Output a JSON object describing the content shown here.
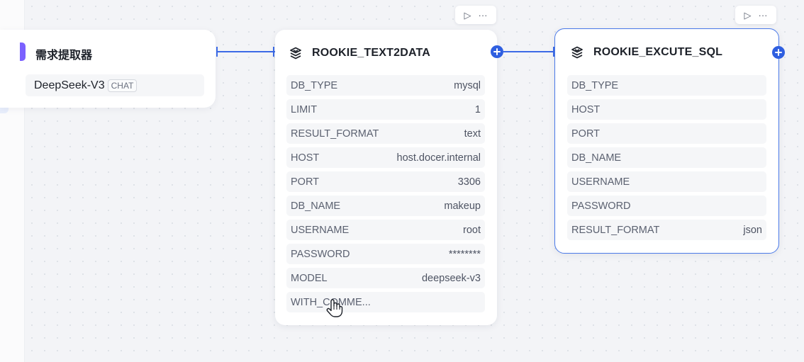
{
  "colors": {
    "accent": "#2f5fe0",
    "edge": "#3c6ae6",
    "selected_border": "#4a79e8",
    "extractor_edge": "#7b61ff"
  },
  "toolbar": {
    "run_icon": "play-icon",
    "more_icon": "more-icon",
    "run_glyph": "▷",
    "more_glyph": "···"
  },
  "extractor_node": {
    "title": "需求提取器",
    "model": "DeepSeek-V3",
    "model_tag": "CHAT"
  },
  "text2data_node": {
    "title": "ROOKIE_TEXT2DATA",
    "params": [
      {
        "name": "DB_TYPE",
        "value": "mysql"
      },
      {
        "name": "LIMIT",
        "value": "1"
      },
      {
        "name": "RESULT_FORMAT",
        "value": "text"
      },
      {
        "name": "HOST",
        "value": "host.docer.internal"
      },
      {
        "name": "PORT",
        "value": "3306"
      },
      {
        "name": "DB_NAME",
        "value": "makeup"
      },
      {
        "name": "USERNAME",
        "value": "root"
      },
      {
        "name": "PASSWORD",
        "value": "********"
      },
      {
        "name": "MODEL",
        "value": "deepseek-v3"
      },
      {
        "name": "WITH_COMME...",
        "value": ""
      }
    ]
  },
  "excute_sql_node": {
    "title": "ROOKIE_EXCUTE_SQL",
    "params": [
      {
        "name": "DB_TYPE",
        "value": ""
      },
      {
        "name": "HOST",
        "value": ""
      },
      {
        "name": "PORT",
        "value": ""
      },
      {
        "name": "DB_NAME",
        "value": ""
      },
      {
        "name": "USERNAME",
        "value": ""
      },
      {
        "name": "PASSWORD",
        "value": ""
      },
      {
        "name": "RESULT_FORMAT",
        "value": "json"
      }
    ]
  }
}
